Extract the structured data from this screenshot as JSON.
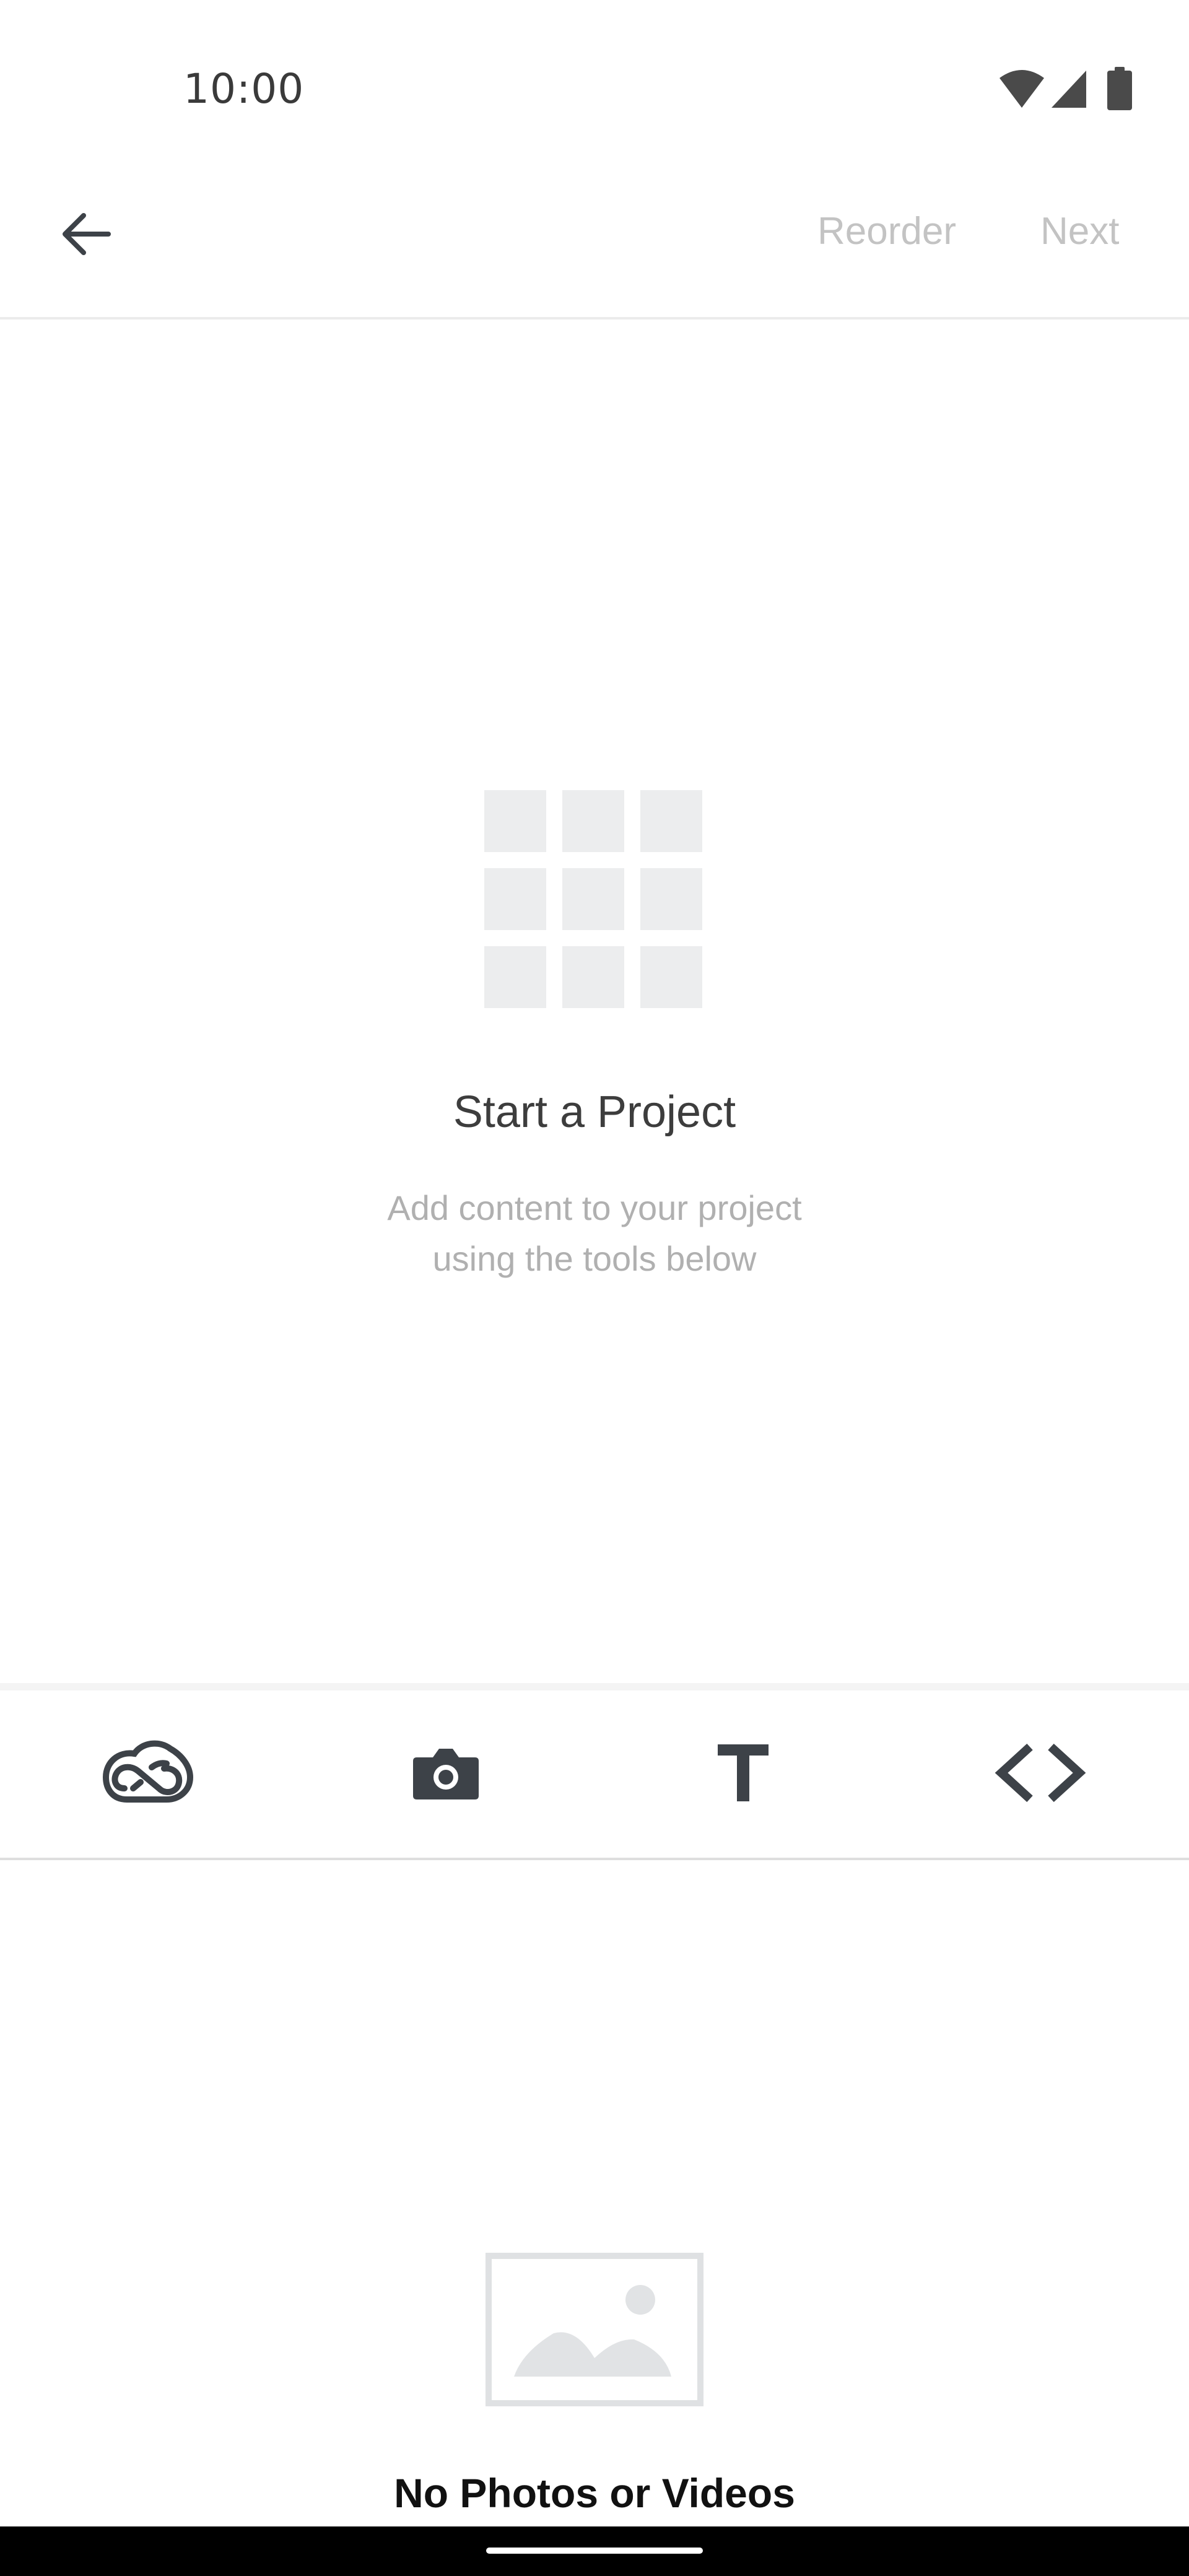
{
  "status_bar": {
    "time": "10:00",
    "icons": [
      "wifi-icon",
      "cellular-signal-icon",
      "battery-icon"
    ]
  },
  "header": {
    "back_icon": "arrow-left-icon",
    "reorder_label": "Reorder",
    "next_label": "Next"
  },
  "empty_state": {
    "icon": "grid-icon",
    "title": "Start a Project",
    "subtitle": "Add content to your project using the tools below"
  },
  "toolbar": {
    "tools": [
      {
        "name": "creative-cloud",
        "icon": "creative-cloud-icon"
      },
      {
        "name": "camera",
        "icon": "camera-icon"
      },
      {
        "name": "text",
        "icon": "text-icon"
      },
      {
        "name": "embed",
        "icon": "code-icon"
      }
    ]
  },
  "media": {
    "empty_title": "No Photos or Videos",
    "icon": "image-placeholder-icon"
  },
  "colors": {
    "disabled_text": "#c3c3c3",
    "icon_dark": "#3d4248",
    "placeholder_gray": "#ecedee"
  }
}
